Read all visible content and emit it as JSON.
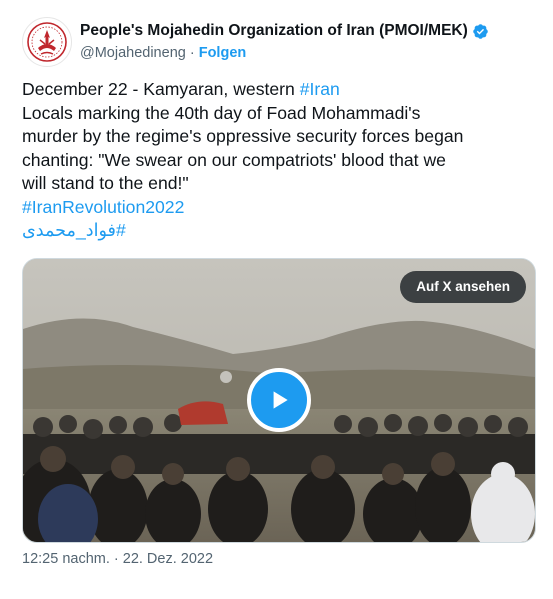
{
  "tweet": {
    "display_name": "People's Mojahedin Organization of Iran (PMOI/MEK)",
    "handle": "@Mojahedineng",
    "separator": " · ",
    "follow_label": "Folgen",
    "body_line1_prefix": "December 22 - Kamyaran, western ",
    "body_line1_hashtag": "#Iran",
    "body_line2": "Locals marking the 40th day of Foad Mohammadi's",
    "body_line3": "murder by the regime's oppressive security forces began",
    "body_line4": "chanting: \"We swear on our compatriots' blood that we",
    "body_line5": "will stand to the end!\"",
    "hashtag_revolution": "#IranRevolution2022",
    "hashtag_persian": "#فواد_محمدی",
    "view_on_x_label": "Auf X ansehen",
    "timestamp": "12:25 nachm. · 22. Dez. 2022"
  },
  "icons": {
    "avatar": "pmoi-logo-icon",
    "verified": "verified-badge-icon",
    "play": "play-icon"
  },
  "colors": {
    "accent": "#1d9bf0",
    "text": "#0f1419",
    "secondary": "#536471"
  }
}
